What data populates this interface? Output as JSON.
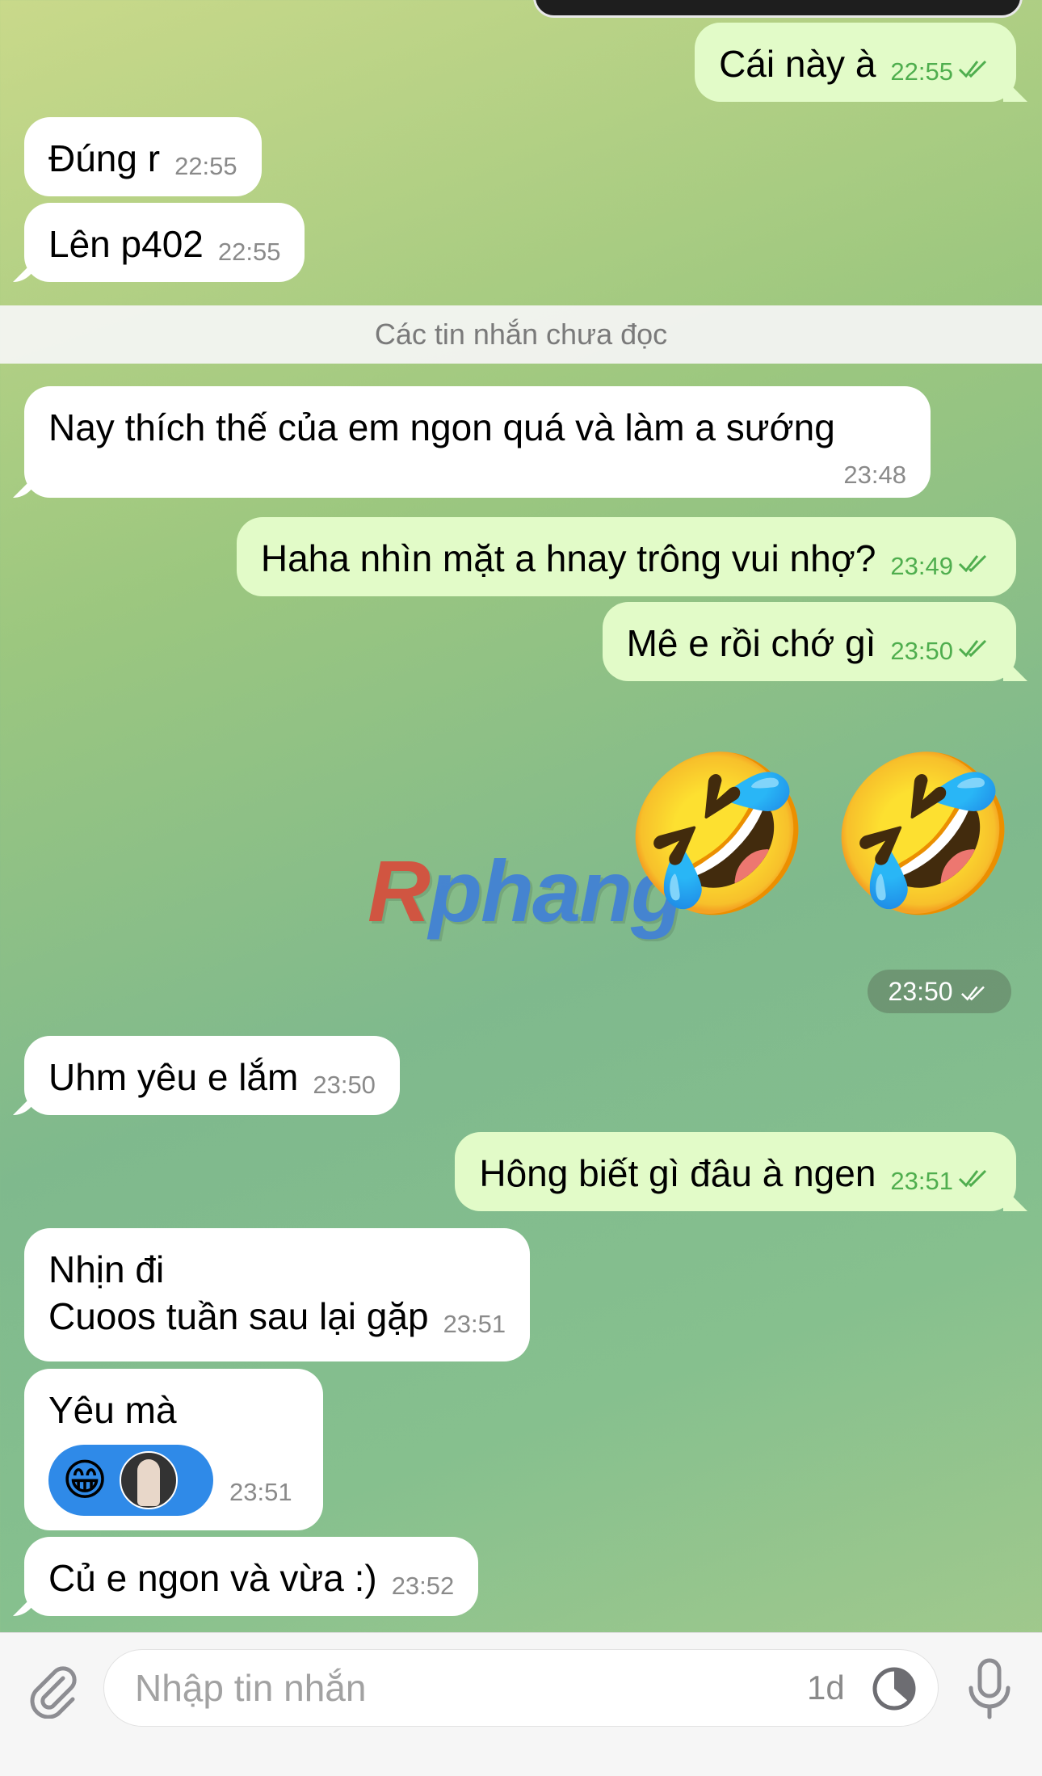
{
  "messages": {
    "m1": {
      "text": "Cái này à",
      "time": "22:55"
    },
    "m2": {
      "text": "Đúng r",
      "time": "22:55"
    },
    "m3": {
      "text": "Lên p402",
      "time": "22:55"
    },
    "m4": {
      "text": "Nay thích thế của em ngon quá và làm a sướng",
      "time": "23:48"
    },
    "m5": {
      "text": "Haha nhìn mặt a hnay trông vui nhợ?",
      "time": "23:49"
    },
    "m6": {
      "text": "Mê e rồi chớ gì",
      "time": "23:50"
    },
    "m7": {
      "emoji": "🤣🤣",
      "time": "23:50"
    },
    "m8": {
      "text": "Uhm yêu e lắm",
      "time": "23:50"
    },
    "m9": {
      "text": "Hông biết gì đâu à ngen",
      "time": "23:51"
    },
    "m10": {
      "line1": "Nhịn đi",
      "line2": "Cuoos tuần sau lại gặp",
      "time": "23:51"
    },
    "m11": {
      "text": "Yêu mà",
      "reaction_emoji": "😁",
      "time": "23:51"
    },
    "m12": {
      "text": "Củ e ngon và vừa :)",
      "time": "23:52"
    }
  },
  "unread_divider": "Các tin nhắn chưa đọc",
  "watermark": {
    "r": "R",
    "rest": "phang"
  },
  "input": {
    "placeholder": "Nhập tin nhắn",
    "timer": "1d"
  },
  "colors": {
    "outgoing": "#e2fbc8",
    "incoming": "#ffffff",
    "check": "#4fae4e",
    "reaction": "#2f8ae8"
  },
  "icons": [
    "attach-icon",
    "timer-icon",
    "microphone-icon",
    "double-check-icon"
  ]
}
